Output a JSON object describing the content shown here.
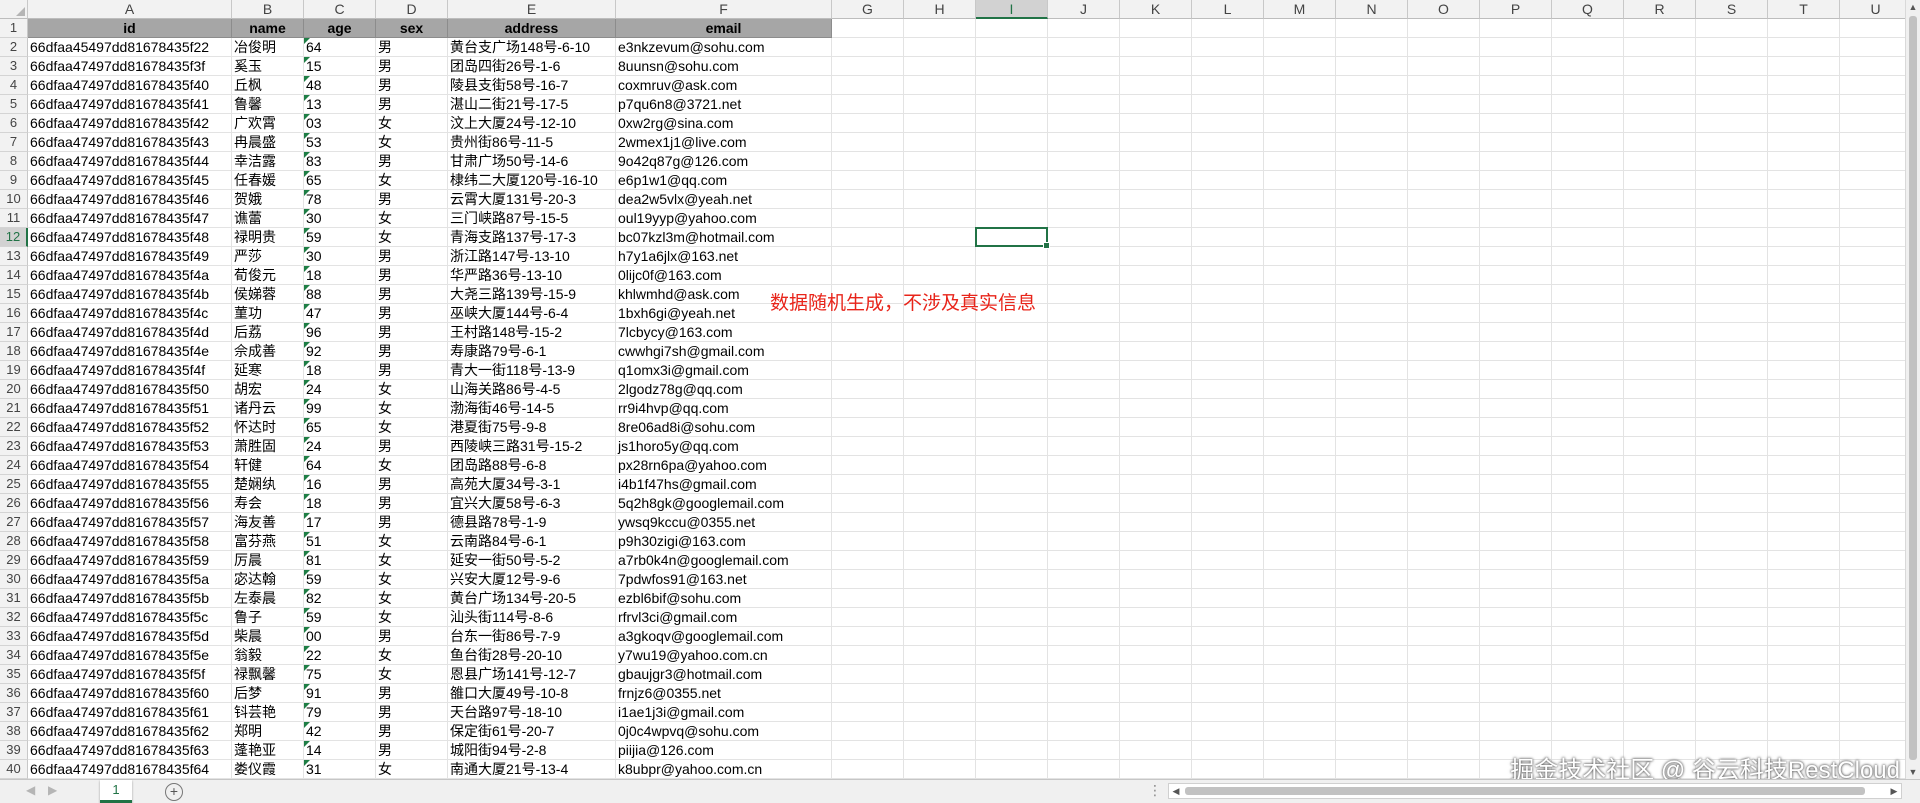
{
  "columns": [
    "A",
    "B",
    "C",
    "D",
    "E",
    "F",
    "G",
    "H",
    "I",
    "J",
    "K",
    "L",
    "M",
    "N",
    "O",
    "P",
    "Q",
    "R",
    "S",
    "T",
    "U"
  ],
  "selected_column": "I",
  "selected_row": "12",
  "header_row": {
    "row_number": "1",
    "cells": [
      "id",
      "name",
      "age",
      "sex",
      "address",
      "email"
    ]
  },
  "rows": [
    {
      "n": "2",
      "cells": [
        "66dfaa45497dd81678435f22",
        "冶俊明",
        "64",
        "男",
        "黄台支广场148号-6-10",
        "e3nkzevum@sohu.com"
      ]
    },
    {
      "n": "3",
      "cells": [
        "66dfaa47497dd81678435f3f",
        "奚玉",
        "15",
        "男",
        "团岛四街26号-1-6",
        "8uunsn@sohu.com"
      ]
    },
    {
      "n": "4",
      "cells": [
        "66dfaa47497dd81678435f40",
        "丘枫",
        "48",
        "男",
        "陵县支街58号-16-7",
        "coxmruv@ask.com"
      ]
    },
    {
      "n": "5",
      "cells": [
        "66dfaa47497dd81678435f41",
        "鲁馨",
        "13",
        "男",
        "湛山二街21号-17-5",
        "p7qu6n8@3721.net"
      ]
    },
    {
      "n": "6",
      "cells": [
        "66dfaa47497dd81678435f42",
        "广欢霄",
        "03",
        "女",
        "汶上大厦24号-12-10",
        "0xw2rg@sina.com"
      ]
    },
    {
      "n": "7",
      "cells": [
        "66dfaa47497dd81678435f43",
        "冉晨盛",
        "53",
        "女",
        "贵州街86号-11-5",
        "2wmex1j1@live.com"
      ]
    },
    {
      "n": "8",
      "cells": [
        "66dfaa47497dd81678435f44",
        "幸洁露",
        "83",
        "男",
        "甘肃广场50号-14-6",
        "9o42q87g@126.com"
      ]
    },
    {
      "n": "9",
      "cells": [
        "66dfaa47497dd81678435f45",
        "任春媛",
        "65",
        "女",
        "棣纬二大厦120号-16-10",
        "e6p1w1@qq.com"
      ]
    },
    {
      "n": "10",
      "cells": [
        "66dfaa47497dd81678435f46",
        "贺娥",
        "78",
        "男",
        "云霄大厦131号-20-3",
        "dea2w5vlx@yeah.net"
      ]
    },
    {
      "n": "11",
      "cells": [
        "66dfaa47497dd81678435f47",
        "谯蕾",
        "30",
        "女",
        "三门峡路87号-15-5",
        "oul19yyp@yahoo.com"
      ]
    },
    {
      "n": "12",
      "cells": [
        "66dfaa47497dd81678435f48",
        "禄明贵",
        "59",
        "女",
        "青海支路137号-17-3",
        "bc07kzl3m@hotmail.com"
      ]
    },
    {
      "n": "13",
      "cells": [
        "66dfaa47497dd81678435f49",
        "严莎",
        "30",
        "男",
        "浙江路147号-13-10",
        "h7y1a6jlx@163.net"
      ]
    },
    {
      "n": "14",
      "cells": [
        "66dfaa47497dd81678435f4a",
        "荀俊元",
        "18",
        "男",
        "华严路36号-13-10",
        "0lijc0f@163.com"
      ]
    },
    {
      "n": "15",
      "cells": [
        "66dfaa47497dd81678435f4b",
        "侯娣蓉",
        "88",
        "男",
        "大尧三路139号-15-9",
        "khlwmhd@ask.com"
      ]
    },
    {
      "n": "16",
      "cells": [
        "66dfaa47497dd81678435f4c",
        "菫功",
        "47",
        "男",
        "巫峡大厦144号-6-4",
        "1bxh6gi@yeah.net"
      ]
    },
    {
      "n": "17",
      "cells": [
        "66dfaa47497dd81678435f4d",
        "后荔",
        "96",
        "男",
        "王村路148号-15-2",
        "7lcbycy@163.com"
      ]
    },
    {
      "n": "18",
      "cells": [
        "66dfaa47497dd81678435f4e",
        "佘成善",
        "92",
        "男",
        "寿康路79号-6-1",
        "cwwhgi7sh@gmail.com"
      ]
    },
    {
      "n": "19",
      "cells": [
        "66dfaa47497dd81678435f4f",
        "延寒",
        "18",
        "男",
        "青大一街118号-13-9",
        "q1omx3i@gmail.com"
      ]
    },
    {
      "n": "20",
      "cells": [
        "66dfaa47497dd81678435f50",
        "胡宏",
        "24",
        "女",
        "山海关路86号-4-5",
        "2lgodz78g@qq.com"
      ]
    },
    {
      "n": "21",
      "cells": [
        "66dfaa47497dd81678435f51",
        "诸丹云",
        "99",
        "女",
        "渤海街46号-14-5",
        "rr9i4hvp@qq.com"
      ]
    },
    {
      "n": "22",
      "cells": [
        "66dfaa47497dd81678435f52",
        "怀达时",
        "65",
        "女",
        "港夏街75号-9-8",
        "8re06ad8i@sohu.com"
      ]
    },
    {
      "n": "23",
      "cells": [
        "66dfaa47497dd81678435f53",
        "萧胜固",
        "24",
        "男",
        "西陵峡三路31号-15-2",
        "js1horo5y@qq.com"
      ]
    },
    {
      "n": "24",
      "cells": [
        "66dfaa47497dd81678435f54",
        "轩健",
        "64",
        "女",
        "团岛路88号-6-8",
        "px28rn6pa@yahoo.com"
      ]
    },
    {
      "n": "25",
      "cells": [
        "66dfaa47497dd81678435f55",
        "楚娴纨",
        "16",
        "男",
        "高苑大厦34号-3-1",
        "i4b1f47hs@gmail.com"
      ]
    },
    {
      "n": "26",
      "cells": [
        "66dfaa47497dd81678435f56",
        "寿会",
        "18",
        "男",
        "宜兴大厦58号-6-3",
        "5q2h8gk@googlemail.com"
      ]
    },
    {
      "n": "27",
      "cells": [
        "66dfaa47497dd81678435f57",
        "海友善",
        "17",
        "男",
        "德县路78号-1-9",
        "ywsq9kccu@0355.net"
      ]
    },
    {
      "n": "28",
      "cells": [
        "66dfaa47497dd81678435f58",
        "富芬燕",
        "51",
        "女",
        "云南路84号-6-1",
        "p9h30zigi@163.com"
      ]
    },
    {
      "n": "29",
      "cells": [
        "66dfaa47497dd81678435f59",
        "厉晨",
        "81",
        "女",
        "延安一街50号-5-2",
        "a7rb0k4n@googlemail.com"
      ]
    },
    {
      "n": "30",
      "cells": [
        "66dfaa47497dd81678435f5a",
        "宓达翰",
        "59",
        "女",
        "兴安大厦12号-9-6",
        "7pdwfos91@163.net"
      ]
    },
    {
      "n": "31",
      "cells": [
        "66dfaa47497dd81678435f5b",
        "左泰晨",
        "82",
        "女",
        "黄台广场134号-20-5",
        "ezbl6bif@sohu.com"
      ]
    },
    {
      "n": "32",
      "cells": [
        "66dfaa47497dd81678435f5c",
        "鲁子",
        "59",
        "女",
        "汕头街114号-8-6",
        "rfrvl3ci@gmail.com"
      ]
    },
    {
      "n": "33",
      "cells": [
        "66dfaa47497dd81678435f5d",
        "柴晨",
        "00",
        "男",
        "台东一街86号-7-9",
        "a3gkoqv@googlemail.com"
      ]
    },
    {
      "n": "34",
      "cells": [
        "66dfaa47497dd81678435f5e",
        "翁毅",
        "22",
        "女",
        "鱼台街28号-20-10",
        "y7wu19@yahoo.com.cn"
      ]
    },
    {
      "n": "35",
      "cells": [
        "66dfaa47497dd81678435f5f",
        "禄飘馨",
        "75",
        "女",
        "恩县广场141号-12-7",
        "gbaujgr3@hotmail.com"
      ]
    },
    {
      "n": "36",
      "cells": [
        "66dfaa47497dd81678435f60",
        "后梦",
        "91",
        "男",
        "雒口大厦49号-10-8",
        "frnjz6@0355.net"
      ]
    },
    {
      "n": "37",
      "cells": [
        "66dfaa47497dd81678435f61",
        "钭芸艳",
        "79",
        "男",
        "天台路97号-18-10",
        "i1ae1j3i@gmail.com"
      ]
    },
    {
      "n": "38",
      "cells": [
        "66dfaa47497dd81678435f62",
        "郑明",
        "42",
        "男",
        "保定街61号-20-7",
        "0j0c4wpvq@sohu.com"
      ]
    },
    {
      "n": "39",
      "cells": [
        "66dfaa47497dd81678435f63",
        "蓬艳亚",
        "14",
        "男",
        "城阳街94号-2-8",
        "piijia@126.com"
      ]
    },
    {
      "n": "40",
      "cells": [
        "66dfaa47497dd81678435f64",
        "娄仪霞",
        "31",
        "女",
        "南通大厦21号-13-4",
        "k8ubpr@yahoo.com.cn"
      ]
    }
  ],
  "note": "数据随机生成，不涉及真实信息",
  "watermark": "掘金技术社区 @ 谷云科技RestCloud",
  "sheet_tab": "1",
  "add_sheet": "⊕",
  "icons": {
    "prev": "◀",
    "next": "▶",
    "up": "▲",
    "down": "▼",
    "dots": "⋮"
  },
  "colors": {
    "accent": "#217346",
    "note": "#e8241a",
    "header_fill": "#a6a6a6"
  }
}
